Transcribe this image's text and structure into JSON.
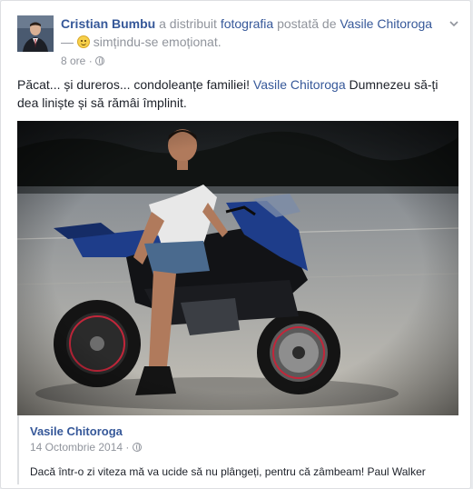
{
  "post": {
    "author": "Cristian Bumbu",
    "action_text": " a distribuit ",
    "photo_link": "fotografia",
    "posted_by_text": " postată de ",
    "original_author_line": "Vasile Chitoroga",
    "feeling_prefix": " — ",
    "feeling": "simțindu-se emoționat.",
    "time": "8 ore",
    "time_separator": " · ",
    "message_before": "Păcat... și dureros... condoleanțe familiei! ",
    "message_link": "Vasile Chitoroga",
    "message_after": " Dumnezeu să-ți dea liniște și să rămâi împlinit."
  },
  "shared": {
    "author": "Vasile Chitoroga",
    "date": "14 Octombrie 2014",
    "date_separator": " · ",
    "text": "Dacă într-o zi viteza mă va ucide să nu plângeți, pentru că zâmbeam! Paul Walker"
  },
  "icons": {
    "options": "chevron-down-icon",
    "privacy": "globe-icon",
    "feeling": "emoji-icon"
  },
  "colors": {
    "link": "#365899",
    "meta": "#90949c",
    "text": "#1d2129",
    "border": "#dddfe2"
  }
}
